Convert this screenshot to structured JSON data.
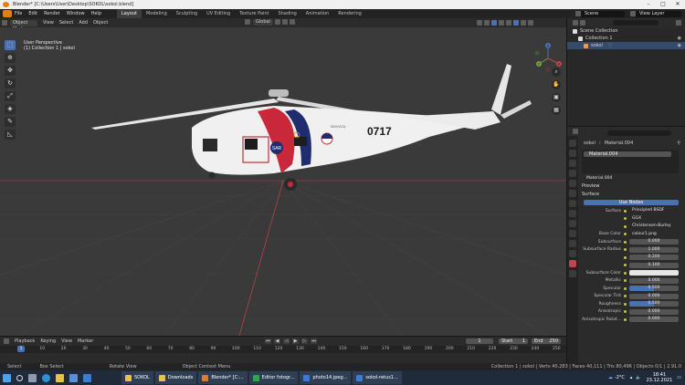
{
  "window": {
    "title": "Blender* [C:\\Users\\User\\Desktop\\SOKOL\\sokol.blend]"
  },
  "menu": [
    "File",
    "Edit",
    "Render",
    "Window",
    "Help"
  ],
  "workspaces": [
    "Layout",
    "Modeling",
    "Sculpting",
    "UV Editing",
    "Texture Paint",
    "Shading",
    "Animation",
    "Rendering"
  ],
  "active_workspace": "Layout",
  "top_right": {
    "scene": "Scene",
    "view_layer": "View Layer"
  },
  "viewport_header": {
    "mode": "Object Mode",
    "view": "View",
    "select": "Select",
    "add": "Add",
    "object": "Object",
    "orientation": "Global",
    "options": "Options"
  },
  "viewport_info": {
    "line1": "User Perspective",
    "line2": "(1) Collection 1 | sokol"
  },
  "helicopter": {
    "tail_number": "0717",
    "badge": "SAR",
    "lettering": "NOVCOL"
  },
  "gizmo": {
    "x": "X",
    "y": "Y",
    "z": "Z"
  },
  "outliner": {
    "title": "Scene Collection",
    "rows": [
      {
        "label": "Collection 1"
      },
      {
        "label": "sokol"
      }
    ]
  },
  "properties": {
    "object_name": "sokol",
    "material_name": "Material.004",
    "slot": "Material.004",
    "material_field": "Material.004",
    "preview_label": "Preview",
    "surface_label": "Surface",
    "use_nodes": "Use Nodes",
    "rows": [
      {
        "label": "Surface",
        "value": "Principled BSDF",
        "kind": "dark"
      },
      {
        "label": "",
        "value": "GGX",
        "kind": "dark"
      },
      {
        "label": "",
        "value": "Christensen-Burley",
        "kind": "dark"
      },
      {
        "label": "Base Color",
        "value": "colour1.png",
        "kind": "dark"
      },
      {
        "label": "Subsurface",
        "value": "0.000",
        "kind": "num"
      },
      {
        "label": "Subsurface Radius",
        "value": "1.000",
        "kind": "num"
      },
      {
        "label": "",
        "value": "0.200",
        "kind": "num"
      },
      {
        "label": "",
        "value": "0.100",
        "kind": "num"
      },
      {
        "label": "Subsurface Color",
        "value": "",
        "kind": "white"
      },
      {
        "label": "Metallic",
        "value": "0.000",
        "kind": "num"
      },
      {
        "label": "Specular",
        "value": "0.500",
        "kind": "slider",
        "fill": 0.5
      },
      {
        "label": "Specular Tint",
        "value": "0.000",
        "kind": "num"
      },
      {
        "label": "Roughness",
        "value": "0.500",
        "kind": "slider",
        "fill": 0.5
      },
      {
        "label": "Anisotropic",
        "value": "0.000",
        "kind": "num"
      },
      {
        "label": "Anisotropic Rotat...",
        "value": "0.000",
        "kind": "num"
      }
    ]
  },
  "timeline": {
    "menus": [
      "Playback",
      "Keying",
      "View",
      "Marker"
    ],
    "current_frame": "1",
    "start_label": "Start",
    "start": "1",
    "end_label": "End",
    "end": "250",
    "ticks": [
      "1",
      "10",
      "20",
      "30",
      "40",
      "50",
      "60",
      "70",
      "80",
      "90",
      "100",
      "110",
      "120",
      "130",
      "140",
      "150",
      "160",
      "170",
      "180",
      "190",
      "200",
      "210",
      "220",
      "230",
      "240",
      "250"
    ]
  },
  "statusbar": {
    "select": "Select",
    "box_select": "Box Select",
    "rotate_view": "Rotate View",
    "context_menu": "Object Context Menu",
    "stats": "Collection 1 | sokol | Verts 40,283 | Faces 40,111 | Tris 80,496 | Objects 0/1 | 2.91.0"
  },
  "taskbar": {
    "apps": [
      "SOKOL",
      "Downloads",
      "Blender* [C:...",
      "Editor fotogr...",
      "photo14.jpeg...",
      "sokol-retus1..."
    ],
    "weather": "-2°C",
    "time": "18:41",
    "date": "23.12.2021"
  },
  "colors": {
    "accent": "#4772b3",
    "blender_orange": "#e87d0d",
    "axis_red": "#c2444e",
    "axis_green": "#74a03f"
  }
}
